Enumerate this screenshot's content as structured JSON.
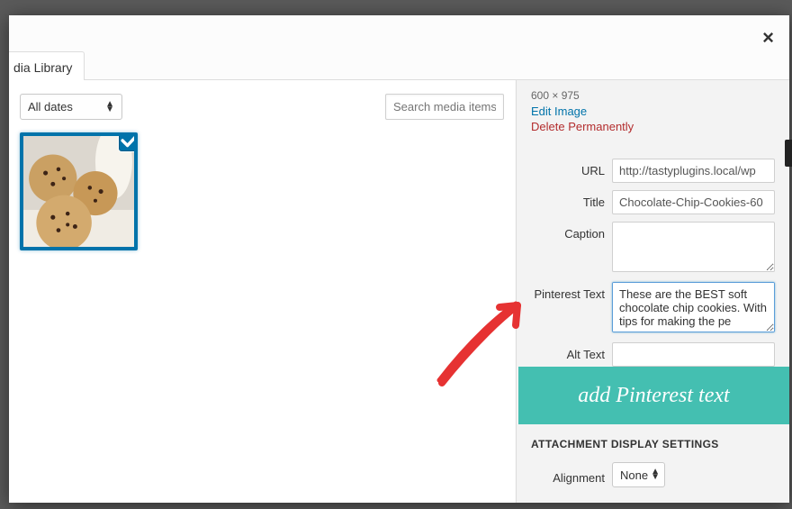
{
  "tab": {
    "label": "dia Library"
  },
  "toolbar": {
    "dateFilterValue": "All dates",
    "searchPlaceholder": "Search media items."
  },
  "details": {
    "dimensions": "600 × 975",
    "editImage": "Edit Image",
    "deletePermanently": "Delete Permanently"
  },
  "fields": {
    "url": {
      "label": "URL",
      "value": "http://tastyplugins.local/wp"
    },
    "title": {
      "label": "Title",
      "value": "Chocolate-Chip-Cookies-60"
    },
    "caption": {
      "label": "Caption",
      "value": ""
    },
    "pinterest": {
      "label": "Pinterest Text",
      "value": "These are the BEST soft chocolate chip cookies. With tips for making the pe"
    },
    "alt": {
      "label": "Alt Text",
      "value": ""
    }
  },
  "callout": {
    "label": "add Pinterest text"
  },
  "attach": {
    "header": "ATTACHMENT DISPLAY SETTINGS",
    "alignment": {
      "label": "Alignment",
      "value": "None"
    }
  }
}
